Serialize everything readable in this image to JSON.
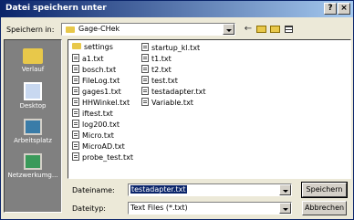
{
  "window": {
    "title": "Datei speichern unter",
    "help_label": "?",
    "close_label": "×"
  },
  "location": {
    "label": "Speichern in:",
    "value": "Gage-CHek"
  },
  "places": [
    {
      "label": "Verlauf"
    },
    {
      "label": "Desktop"
    },
    {
      "label": "Arbeitsplatz"
    },
    {
      "label": "Netzwerkumg..."
    }
  ],
  "files": {
    "col1": [
      "settings",
      "a1.txt",
      "bosch.txt",
      "FileLog.txt",
      "gages1.txt",
      "HHWinkel.txt",
      "iftest.txt",
      "log200.txt",
      "Micro.txt",
      "MicroAD.txt",
      "probe_test.txt"
    ],
    "col2": [
      "startup_kl.txt",
      "t1.txt",
      "t2.txt",
      "test.txt",
      "testadapter.txt",
      "Variable.txt"
    ]
  },
  "filename": {
    "label": "Dateiname:",
    "value": "testadapter.txt"
  },
  "filetype": {
    "label": "Dateityp:",
    "value": "Text Files (*.txt)"
  },
  "buttons": {
    "save": "Speichern",
    "cancel": "Abbrechen"
  }
}
